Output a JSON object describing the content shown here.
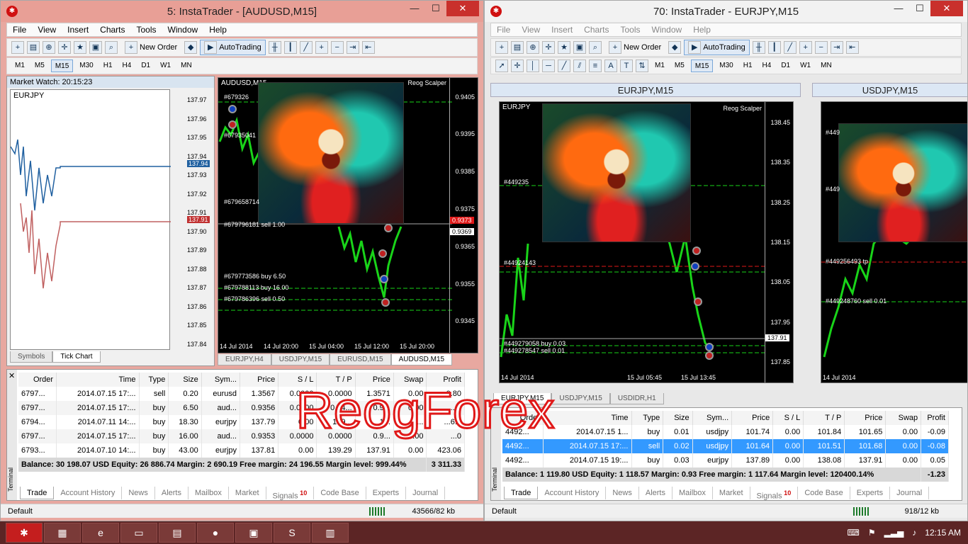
{
  "left": {
    "title": "5: InstaTrader - [AUDUSD,M15]",
    "menu": [
      "File",
      "View",
      "Insert",
      "Charts",
      "Tools",
      "Window",
      "Help"
    ],
    "toolbar": {
      "new_order": "New Order",
      "autotrading": "AutoTrading"
    },
    "timeframes": [
      "M1",
      "M5",
      "M15",
      "M30",
      "H1",
      "H4",
      "D1",
      "W1",
      "MN"
    ],
    "active_tf": "M15",
    "market_watch": {
      "title": "Market Watch: 20:15:23",
      "symbol": "EURJPY",
      "prices": [
        "137.97",
        "137.96",
        "137.95",
        "137.94",
        "137.93",
        "137.92",
        "137.91",
        "137.90",
        "137.89",
        "137.88",
        "137.87",
        "137.86",
        "137.85",
        "137.84"
      ],
      "ask": "137.94",
      "bid": "137.91",
      "tabs": [
        "Symbols",
        "Tick Chart"
      ]
    },
    "chart": {
      "symbol": "AUDUSD,M15",
      "indicator": "Reog Scalper",
      "prices": [
        "0.9405",
        "0.9395",
        "0.9385",
        "0.9375",
        "0.9365",
        "0.9355",
        "0.9345"
      ],
      "price_tags": [
        "0.9373",
        "0.9369"
      ],
      "orders": [
        "#679326",
        "#67935041",
        "#679658714",
        "#679796181 sell 1.00",
        "#679773586 buy 6.50",
        "#679788113 buy 16.00",
        "#679786396 sell 0.50"
      ],
      "dates": [
        "14 Jul 2014",
        "14 Jul 20:00",
        "15 Jul 04:00",
        "15 Jul 12:00",
        "15 Jul 20:00"
      ],
      "tabs": [
        "EURJPY,H4",
        "USDJPY,M15",
        "EURUSD,M15",
        "AUDUSD,M15"
      ]
    },
    "terminal": {
      "headers": [
        "Order",
        "Time",
        "Type",
        "Size",
        "Sym...",
        "Price",
        "S / L",
        "T / P",
        "Price",
        "Swap",
        "Profit"
      ],
      "rows": [
        [
          "6797...",
          "2014.07.15 17:...",
          "sell",
          "0.20",
          "eurusd",
          "1.3567",
          "0.0000",
          "0.0000",
          "1.3571",
          "0.00",
          "-0.80"
        ],
        [
          "6797...",
          "2014.07.15 17:...",
          "buy",
          "6.50",
          "aud...",
          "0.9356",
          "0.0000",
          "0.94...",
          "0.9...",
          "0.00",
          "...0"
        ],
        [
          "6794...",
          "2014.07.11 14:...",
          "buy",
          "18.30",
          "eurjpy",
          "137.79",
          "0.00",
          "139...",
          "1...",
          "...",
          "...6.0"
        ],
        [
          "6797...",
          "2014.07.15 17:...",
          "buy",
          "16.00",
          "aud...",
          "0.9353",
          "0.0000",
          "0.0000",
          "0.9...",
          "0.00",
          "...0"
        ],
        [
          "6793...",
          "2014.07.10 14:...",
          "buy",
          "43.00",
          "eurjpy",
          "137.81",
          "0.00",
          "139.29",
          "137.91",
          "0.00",
          "423.06"
        ]
      ],
      "balance": "Balance: 30 198.07 USD  Equity: 26 886.74  Margin: 2 690.19  Free margin: 24 196.55  Margin level: 999.44%",
      "total": "3 311.33",
      "tabs": [
        "Trade",
        "Account History",
        "News",
        "Alerts",
        "Mailbox",
        "Market",
        "Signals",
        "Code Base",
        "Experts",
        "Journal"
      ],
      "signals_badge": "10",
      "side_label": "Terminal"
    },
    "status": {
      "profile": "Default",
      "traffic": "43566/82 kb"
    }
  },
  "right": {
    "title": "70: InstaTrader - EURJPY,M15",
    "menu": [
      "File",
      "View",
      "Insert",
      "Charts",
      "Tools",
      "Window",
      "Help"
    ],
    "toolbar": {
      "new_order": "New Order",
      "autotrading": "AutoTrading"
    },
    "timeframes": [
      "M1",
      "M5",
      "M15",
      "M30",
      "H1",
      "H4",
      "D1",
      "W1",
      "MN"
    ],
    "active_tf": "M15",
    "chart1": {
      "title": "EURJPY,M15",
      "symbol": "EURJPY",
      "indicator": "Reog Scalper",
      "prices": [
        "138.45",
        "138.35",
        "138.25",
        "138.15",
        "138.05",
        "137.95",
        "137.85"
      ],
      "price_tag": "137.91",
      "orders": [
        "#449235",
        "#44924143",
        "#449279058 buy 0.03",
        "#449278547 sell 0.01"
      ],
      "dates": [
        "14 Jul 2014",
        "15 Jul 05:45",
        "15 Jul 13:45"
      ]
    },
    "chart2": {
      "title": "USDJPY,M15",
      "orders": [
        "#449",
        "#449",
        "#449256493 tp",
        "#449248760 sell 0.01"
      ],
      "dates": [
        "14 Jul 2014"
      ]
    },
    "tabs": [
      "EURJPY,M15",
      "USDJPY,M15",
      "USDIDR,H1"
    ],
    "terminal": {
      "headers": [
        "Order",
        "Time",
        "Type",
        "Size",
        "Sym...",
        "Price",
        "S / L",
        "T / P",
        "Price",
        "Swap",
        "Profit"
      ],
      "rows": [
        [
          "4492...",
          "2014.07.15 1...",
          "buy",
          "0.01",
          "usdjpy",
          "101.74",
          "0.00",
          "101.84",
          "101.65",
          "0.00",
          "-0.09"
        ],
        [
          "4492...",
          "2014.07.15 17:...",
          "sell",
          "0.02",
          "usdjpy",
          "101.64",
          "0.00",
          "101.51",
          "101.68",
          "0.00",
          "-0.08"
        ],
        [
          "4492...",
          "2014.07.15 19:...",
          "buy",
          "0.03",
          "eurjpy",
          "137.89",
          "0.00",
          "138.08",
          "137.91",
          "0.00",
          "0.05"
        ]
      ],
      "balance": "Balance: 1 119.80 USD  Equity: 1 118.57  Margin: 0.93  Free margin: 1 117.64  Margin level: 120400.14%",
      "total": "-1.23",
      "tabs": [
        "Trade",
        "Account History",
        "News",
        "Alerts",
        "Mailbox",
        "Market",
        "Signals",
        "Code Base",
        "Experts",
        "Journal"
      ],
      "signals_badge": "10",
      "side_label": "Terminal"
    },
    "status": {
      "profile": "Default",
      "traffic": "918/12 kb"
    }
  },
  "watermark": "ReogForex",
  "taskbar": {
    "clock": "12:15 AM"
  }
}
